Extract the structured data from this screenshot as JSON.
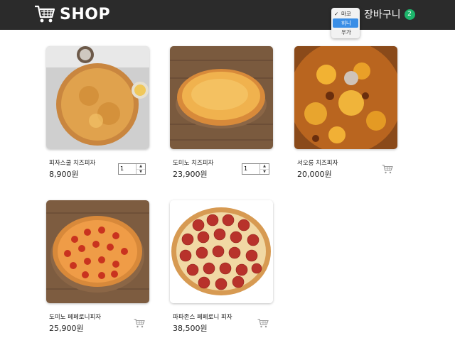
{
  "header": {
    "brand": "SHOP",
    "cart_label": "장바구니",
    "cart_count": "2",
    "icon": "shopping-cart-icon",
    "background": "#2b2b2b",
    "badge_color": "#1db56b"
  },
  "dropdown": {
    "options": [
      "마코",
      "허니",
      "우가"
    ],
    "selected": "마코",
    "highlighted": "허니"
  },
  "products": [
    {
      "name": "피자스쿨 치즈피자",
      "price": "8,900원",
      "quantity": "1",
      "in_cart": true
    },
    {
      "name": "도미노 치즈피자",
      "price": "23,900원",
      "quantity": "1",
      "in_cart": true
    },
    {
      "name": "서오릉 치즈피자",
      "price": "20,000원",
      "in_cart": false,
      "action_icon": "add-to-cart-icon"
    },
    {
      "name": "도미노 페페로니피자",
      "price": "25,900원",
      "in_cart": false,
      "action_icon": "add-to-cart-icon"
    },
    {
      "name": "파파존스 페페로니 피자",
      "price": "38,500원",
      "in_cart": false,
      "action_icon": "add-to-cart-icon"
    }
  ]
}
